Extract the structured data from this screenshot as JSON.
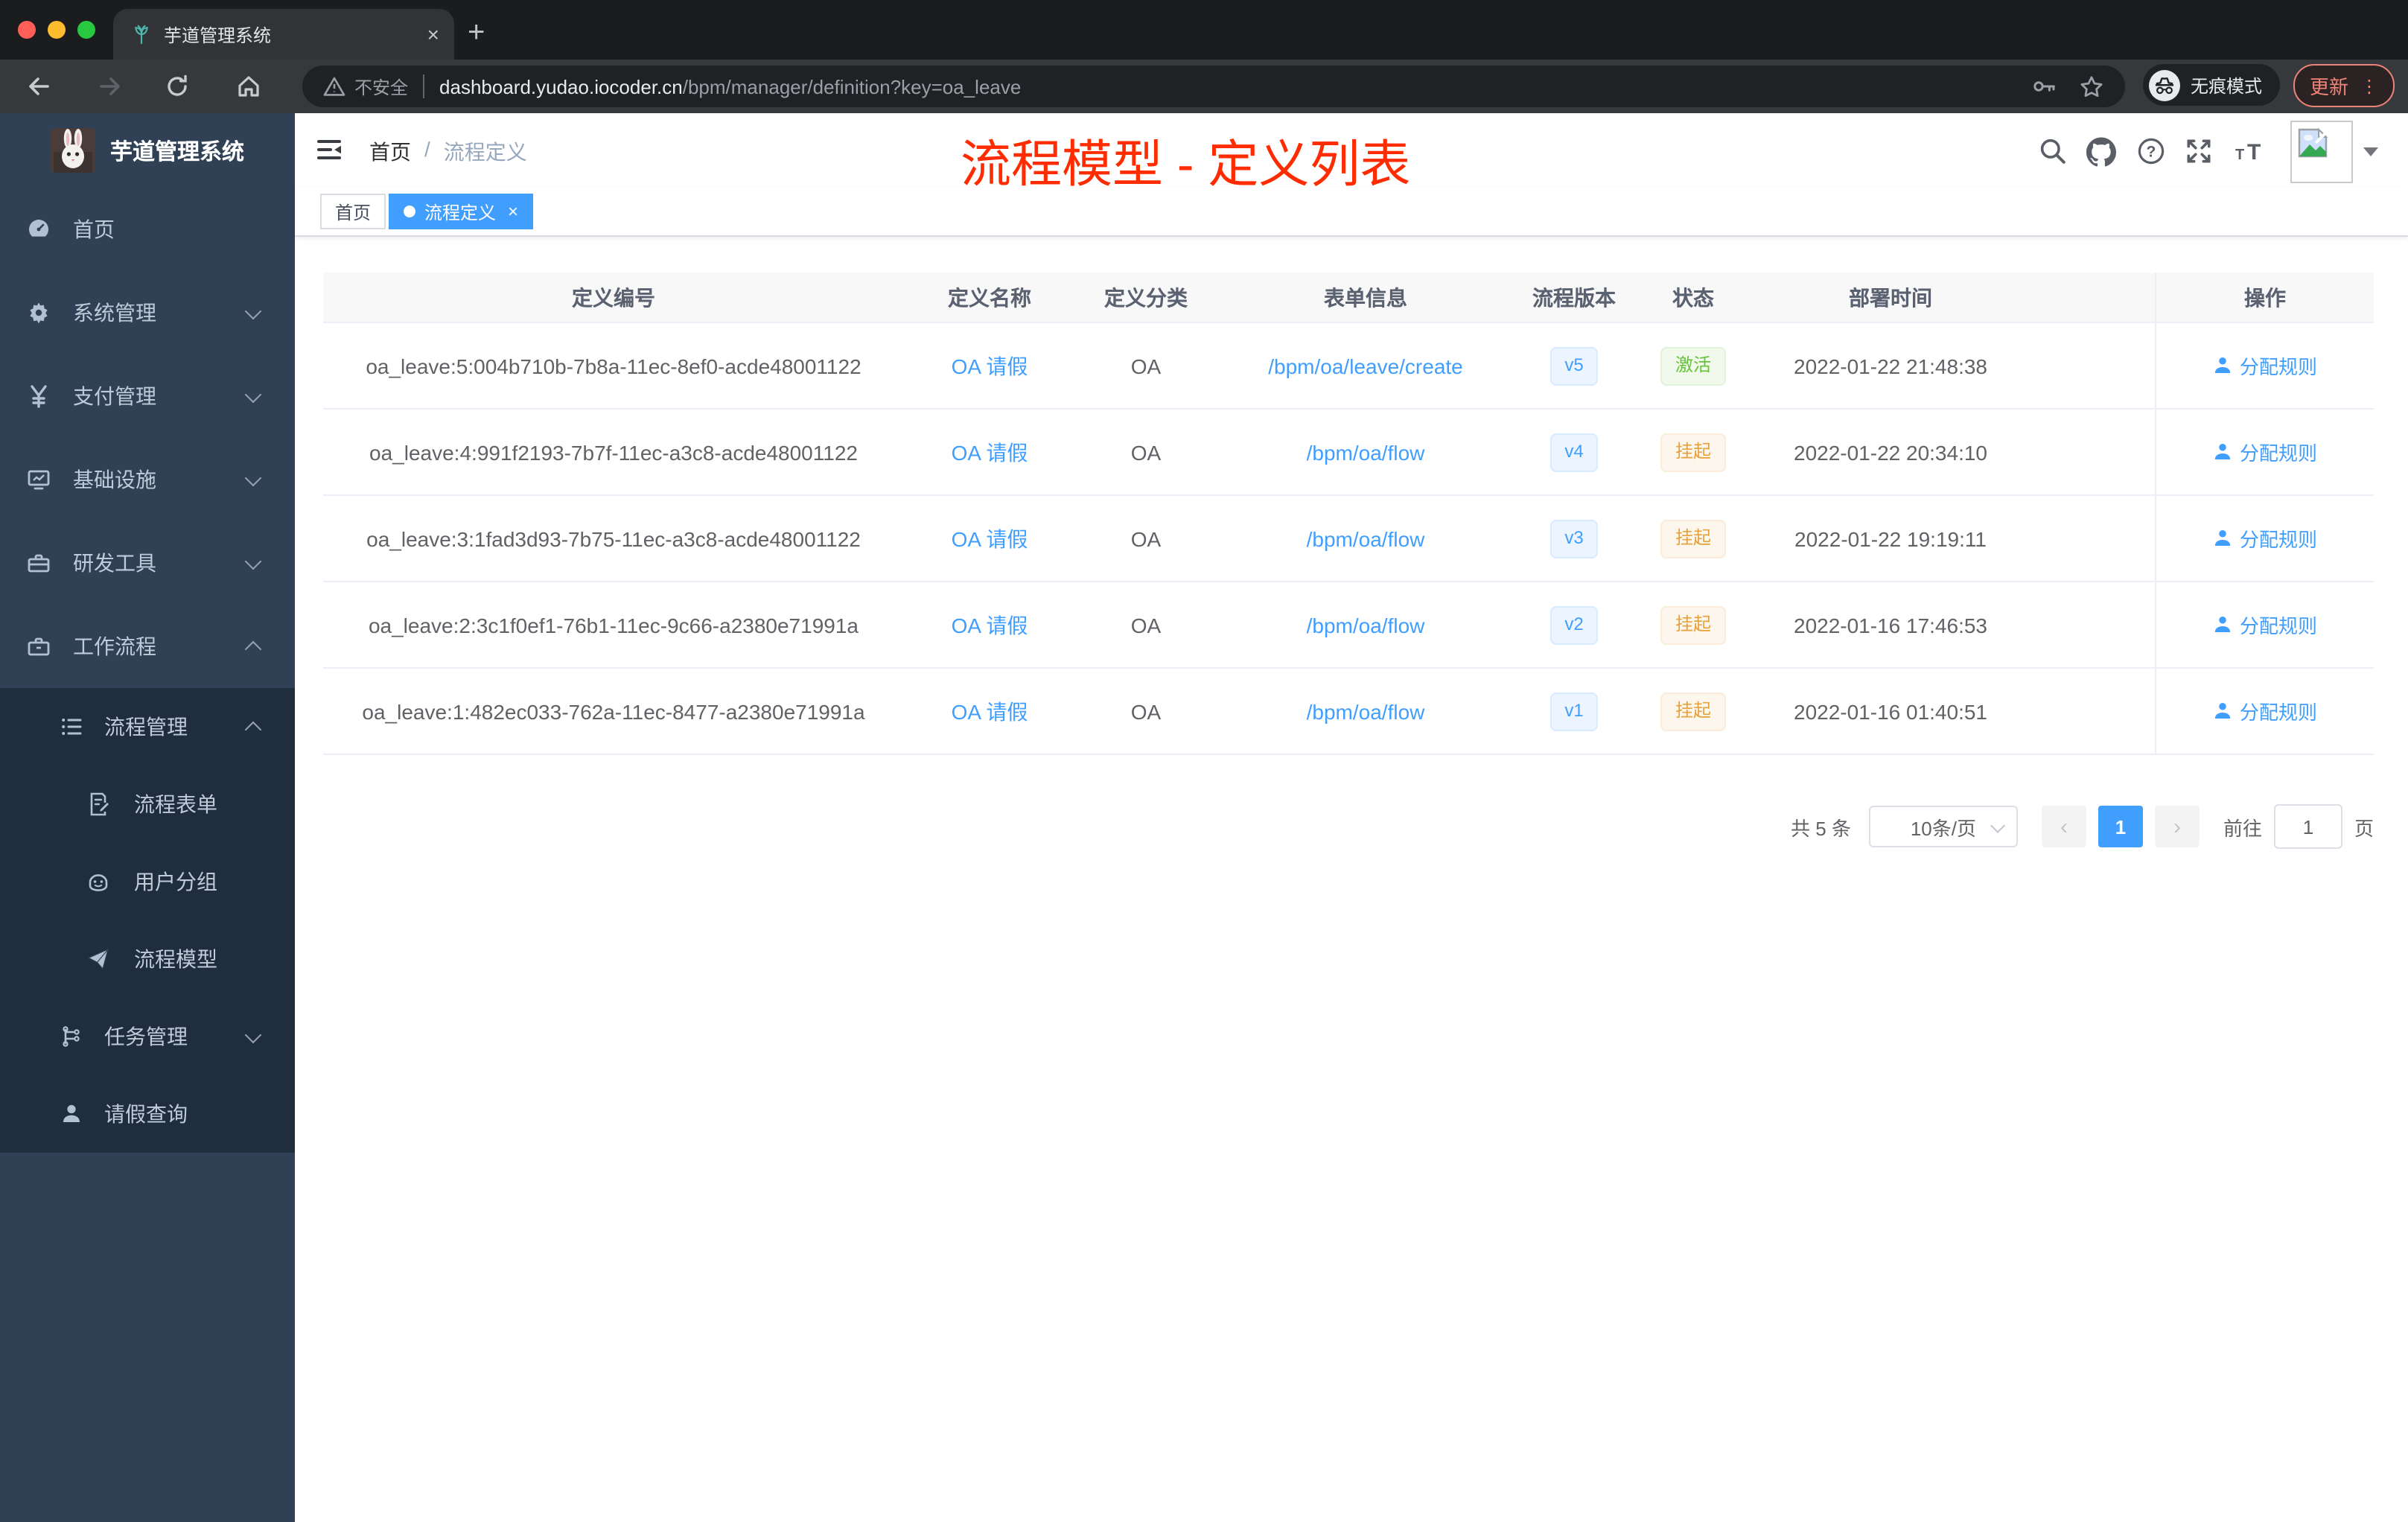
{
  "browser": {
    "tab_title": "芋道管理系统",
    "new_tab": "+",
    "security_label": "不安全",
    "url_host": "dashboard.yudao.iocoder.cn",
    "url_path": "/bpm/manager/definition?key=oa_leave",
    "incognito_label": "无痕模式",
    "update_label": "更新",
    "menu_dots": "⋮",
    "close_glyph": "×"
  },
  "sidebar": {
    "title": "芋道管理系统",
    "items": [
      {
        "label": "首页"
      },
      {
        "label": "系统管理"
      },
      {
        "label": "支付管理"
      },
      {
        "label": "基础设施"
      },
      {
        "label": "研发工具"
      },
      {
        "label": "工作流程"
      },
      {
        "label": "流程管理"
      },
      {
        "label": "流程表单"
      },
      {
        "label": "用户分组"
      },
      {
        "label": "流程模型"
      },
      {
        "label": "任务管理"
      },
      {
        "label": "请假查询"
      }
    ]
  },
  "header": {
    "breadcrumb_home": "首页",
    "breadcrumb_sep": "/",
    "breadcrumb_current": "流程定义",
    "annotation": "流程模型 - 定义列表"
  },
  "tags": {
    "home": "首页",
    "active": "流程定义",
    "close_glyph": "×"
  },
  "table": {
    "columns": [
      "定义编号",
      "定义名称",
      "定义分类",
      "表单信息",
      "流程版本",
      "状态",
      "部署时间",
      "操作"
    ],
    "rows": [
      {
        "id": "oa_leave:5:004b710b-7b8a-11ec-8ef0-acde48001122",
        "name": "OA 请假",
        "category": "OA",
        "form": "/bpm/oa/leave/create",
        "version": "v5",
        "status": "激活",
        "status_class": "success",
        "time": "2022-01-22 21:48:38",
        "action": "分配规则"
      },
      {
        "id": "oa_leave:4:991f2193-7b7f-11ec-a3c8-acde48001122",
        "name": "OA 请假",
        "category": "OA",
        "form": "/bpm/oa/flow",
        "version": "v4",
        "status": "挂起",
        "status_class": "warning",
        "time": "2022-01-22 20:34:10",
        "action": "分配规则"
      },
      {
        "id": "oa_leave:3:1fad3d93-7b75-11ec-a3c8-acde48001122",
        "name": "OA 请假",
        "category": "OA",
        "form": "/bpm/oa/flow",
        "version": "v3",
        "status": "挂起",
        "status_class": "warning",
        "time": "2022-01-22 19:19:11",
        "action": "分配规则"
      },
      {
        "id": "oa_leave:2:3c1f0ef1-76b1-11ec-9c66-a2380e71991a",
        "name": "OA 请假",
        "category": "OA",
        "form": "/bpm/oa/flow",
        "version": "v2",
        "status": "挂起",
        "status_class": "warning",
        "time": "2022-01-16 17:46:53",
        "action": "分配规则"
      },
      {
        "id": "oa_leave:1:482ec033-762a-11ec-8477-a2380e71991a",
        "name": "OA 请假",
        "category": "OA",
        "form": "/bpm/oa/flow",
        "version": "v1",
        "status": "挂起",
        "status_class": "warning",
        "time": "2022-01-16 01:40:51",
        "action": "分配规则"
      }
    ]
  },
  "pagination": {
    "total": "共 5 条",
    "page_size": "10条/页",
    "prev": "‹",
    "current": "1",
    "next": "›",
    "goto_label": "前往",
    "goto_value": "1",
    "page_suffix": "页"
  },
  "colors": {
    "accent": "#409eff",
    "annotation_red": "#fe2c00",
    "success": "#67c23a",
    "warning": "#e6a23c",
    "sidebar_bg": "#304156",
    "submenu_bg": "#1f2d3d",
    "chrome_dark": "#202124",
    "update_red": "#f08478",
    "table_border": "#ebeef5",
    "table_header_bg": "#f8f8f9"
  }
}
